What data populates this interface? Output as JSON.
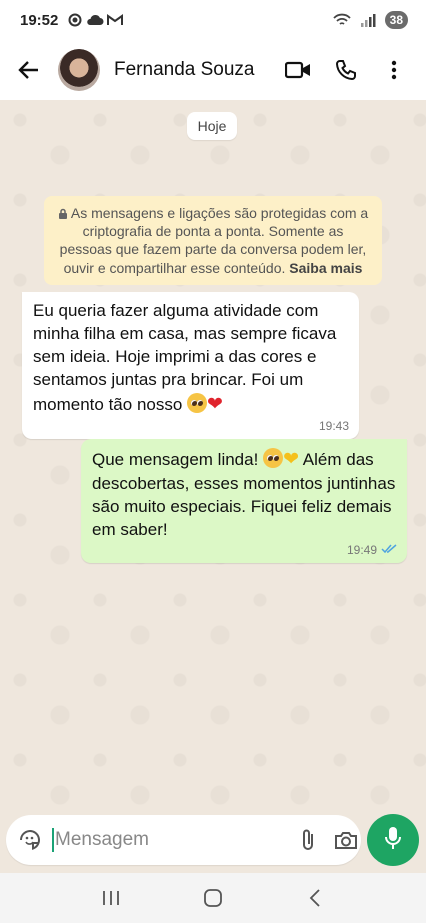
{
  "status_bar": {
    "time": "19:52",
    "battery": "38"
  },
  "header": {
    "contact_name": "Fernanda Souza"
  },
  "chat": {
    "date_chip": "Hoje",
    "encryption_notice": {
      "text": "As mensagens e ligações são protegidas com a criptografia de ponta a ponta. Somente as pessoas que fazem parte da conversa podem ler, ouvir e compartilhar esse conteúdo.",
      "link": "Saiba mais"
    },
    "messages": [
      {
        "direction": "incoming",
        "text": "Eu queria fazer alguma atividade com minha filha em casa, mas sempre ficava sem ideia. Hoje imprimi a das cores e sentamos juntas pra brincar. Foi um momento tão nosso",
        "emojis": [
          "pleading-face",
          "red-heart"
        ],
        "time": "19:43"
      },
      {
        "direction": "outgoing",
        "text_before": "Que mensagem linda!",
        "emojis": [
          "pleading-face",
          "yellow-heart"
        ],
        "text_after": "Além das descobertas, esses momentos juntinhas são muito especiais. Fiquei feliz demais em saber!",
        "time": "19:49",
        "status": "read"
      }
    ]
  },
  "composer": {
    "placeholder": "Mensagem"
  },
  "colors": {
    "accent": "#1ea563",
    "outgoing_bubble": "#dcf8c6",
    "incoming_bubble": "#ffffff",
    "notice_bg": "#fdf0c8",
    "chat_bg": "#efe7dd",
    "read_ticks": "#4fa3e0"
  },
  "icons": {
    "header": [
      "back-arrow-icon",
      "video-call-icon",
      "phone-icon",
      "more-vert-icon"
    ],
    "composer": [
      "sticker-icon",
      "attach-icon",
      "camera-icon",
      "mic-icon"
    ],
    "nav": [
      "recents-icon",
      "home-icon",
      "back-icon"
    ]
  }
}
